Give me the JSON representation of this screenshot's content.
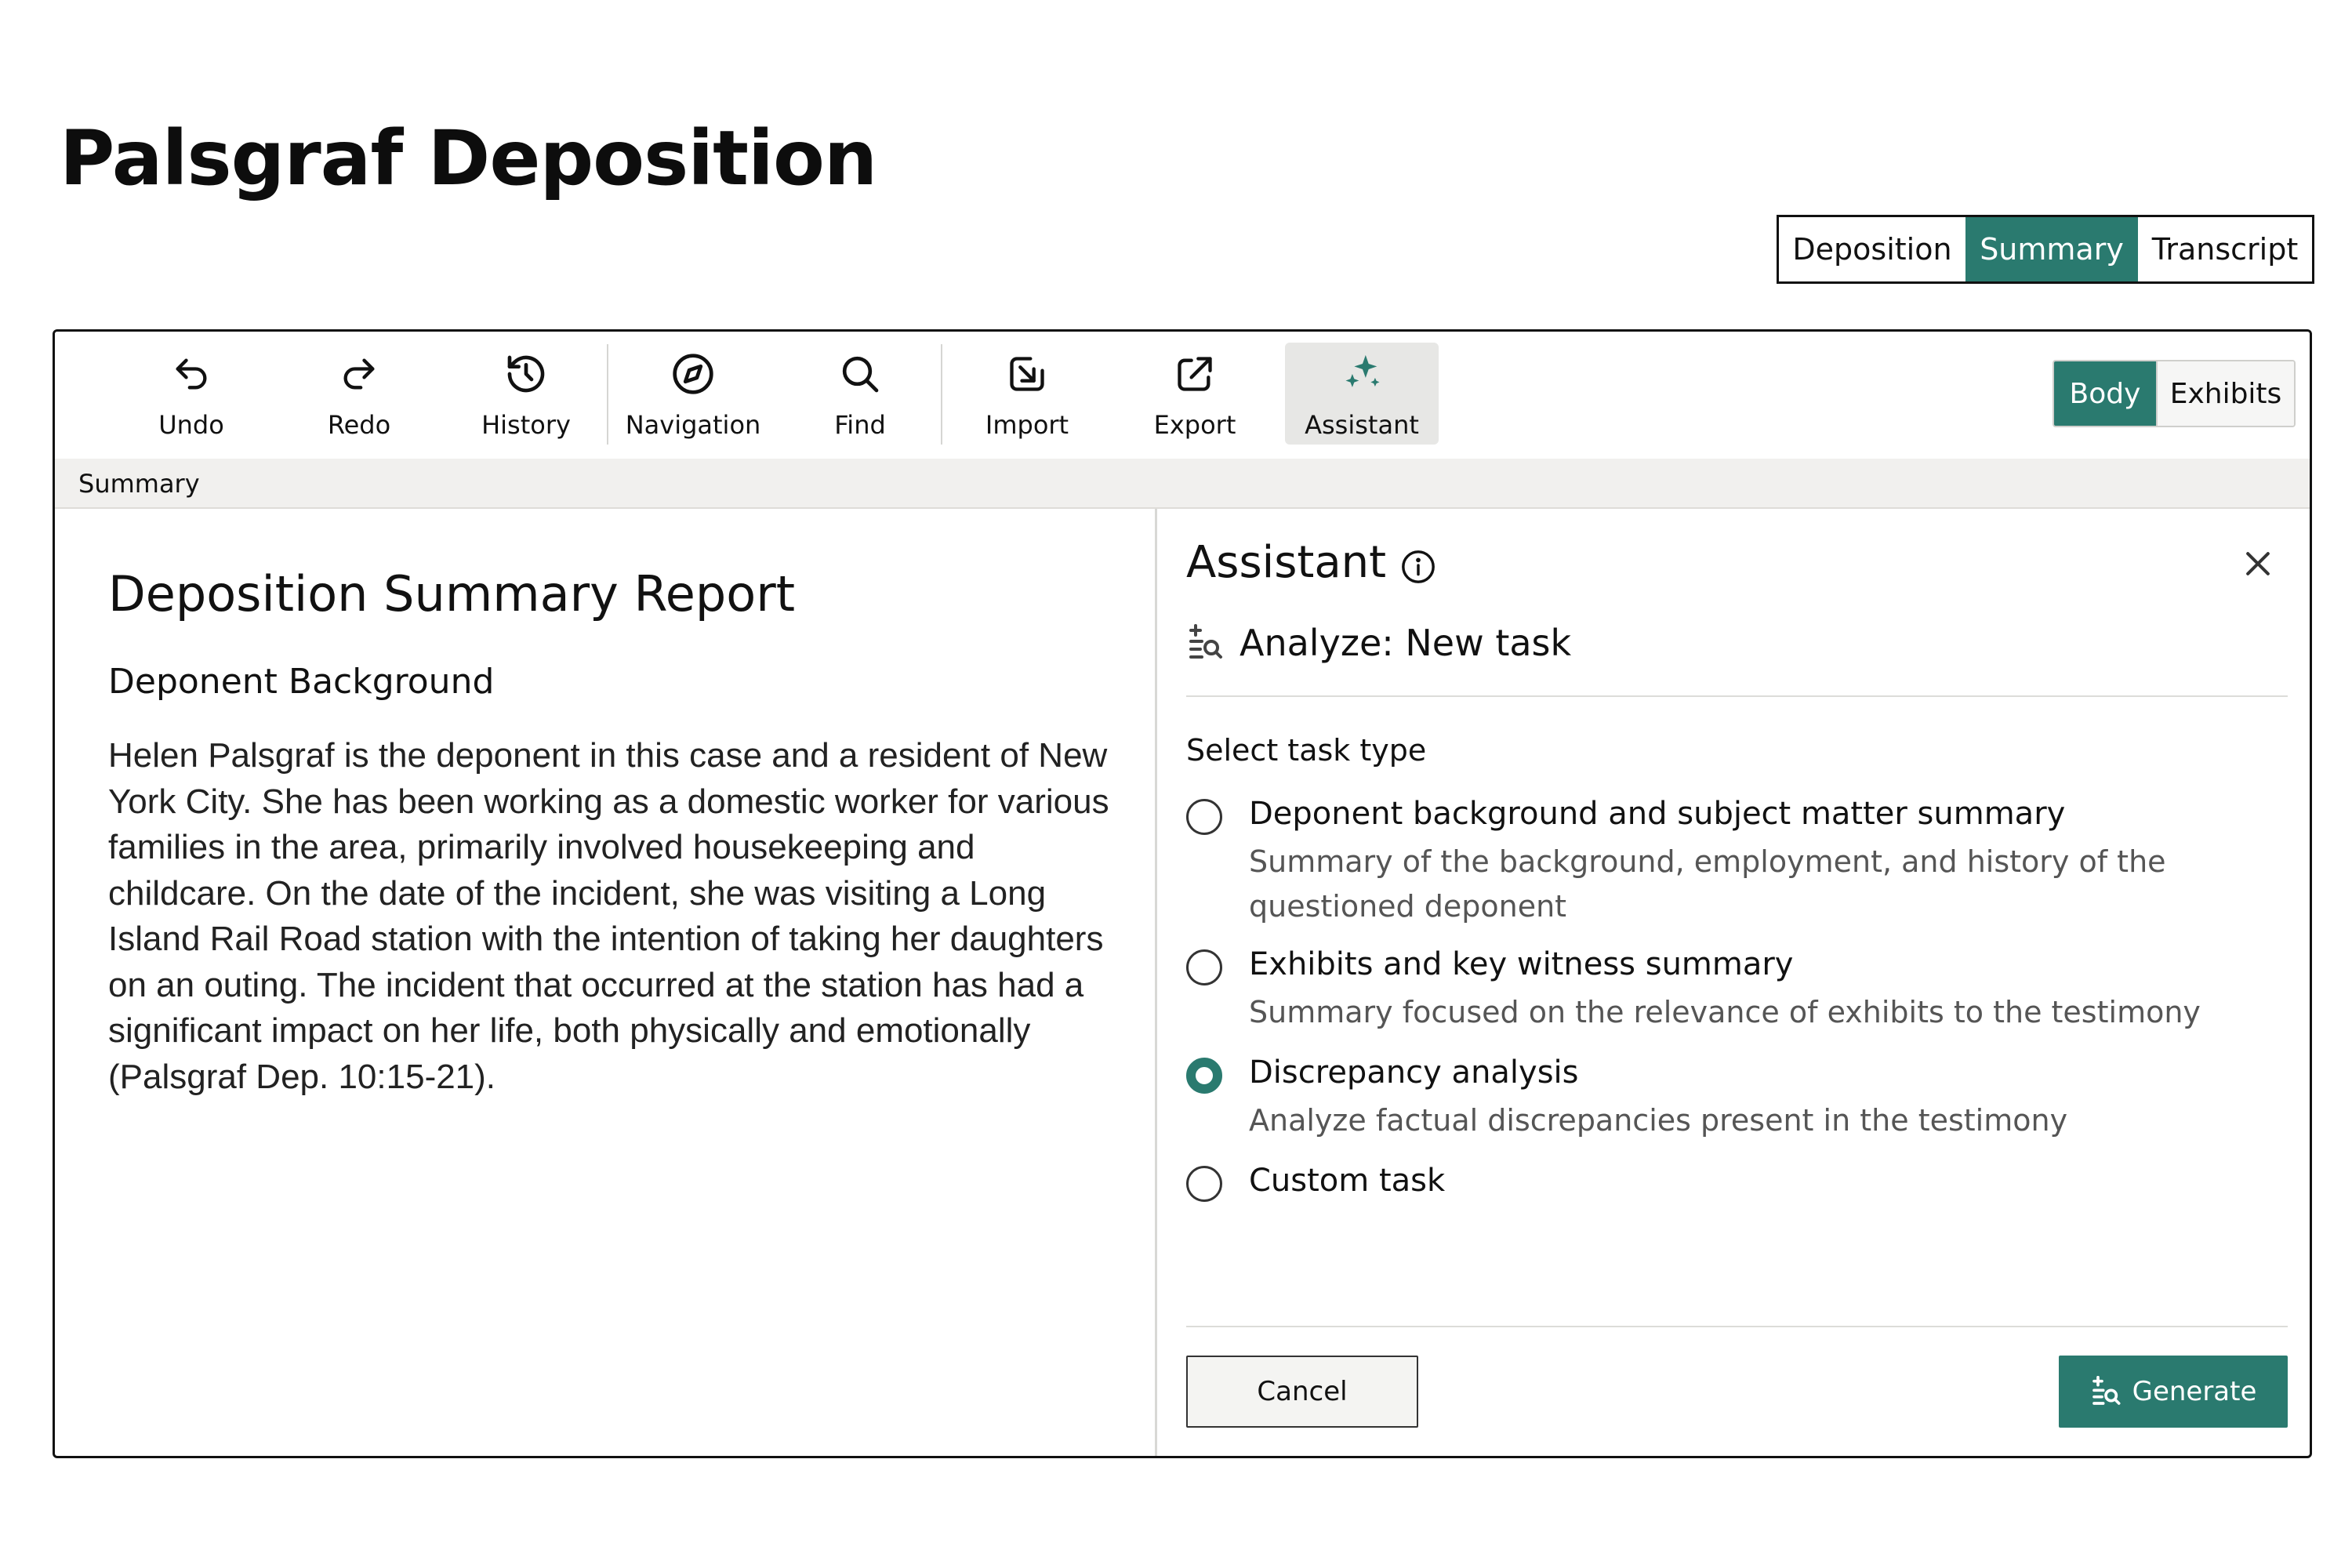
{
  "page": {
    "title": "Palsgraf Deposition"
  },
  "view_tabs": [
    {
      "label": "Deposition",
      "active": false
    },
    {
      "label": "Summary",
      "active": true
    },
    {
      "label": "Transcript",
      "active": false
    }
  ],
  "toolbar": {
    "items": [
      {
        "label": "Undo",
        "icon": "undo-icon"
      },
      {
        "label": "Redo",
        "icon": "redo-icon"
      },
      {
        "label": "History",
        "icon": "history-icon"
      },
      {
        "label": "Navigation",
        "icon": "compass-icon"
      },
      {
        "label": "Find",
        "icon": "search-icon"
      },
      {
        "label": "Import",
        "icon": "import-icon"
      },
      {
        "label": "Export",
        "icon": "export-icon"
      },
      {
        "label": "Assistant",
        "icon": "sparkles-icon",
        "active": true
      }
    ],
    "body_tabs": [
      {
        "label": "Body",
        "active": true
      },
      {
        "label": "Exhibits",
        "active": false
      }
    ]
  },
  "breadcrumb": "Summary",
  "document": {
    "title": "Deposition Summary Report",
    "section_heading": "Deponent Background",
    "paragraph": "Helen Palsgraf is the deponent in this case and a resident of New York City. She has been working as a domestic worker for various families in the area, primarily involved housekeeping and childcare. On the date of the incident, she was visiting a Long Island Rail Road station with the intention of taking her daughters on an outing. The incident that occurred at the station has had a significant impact on her life, both physically and emotionally (Palsgraf Dep. 10:15-21)."
  },
  "assistant": {
    "title": "Assistant",
    "task_title": "Analyze: New task",
    "select_label": "Select task type",
    "options": [
      {
        "title": "Deponent background and subject matter summary",
        "description": "Summary of the background, employment, and history of the questioned deponent",
        "selected": false
      },
      {
        "title": "Exhibits and key witness summary",
        "description": "Summary focused on the relevance of exhibits to the testimony",
        "selected": false
      },
      {
        "title": "Discrepancy analysis",
        "description": "Analyze factual discrepancies present in the testimony",
        "selected": true
      },
      {
        "title": "Custom task",
        "description": "",
        "selected": false
      }
    ],
    "cancel_label": "Cancel",
    "generate_label": "Generate"
  },
  "colors": {
    "accent": "#2a7a6f",
    "toolbar_active_bg": "#e7e7e5",
    "breadcrumb_bg": "#f1f0ee"
  }
}
